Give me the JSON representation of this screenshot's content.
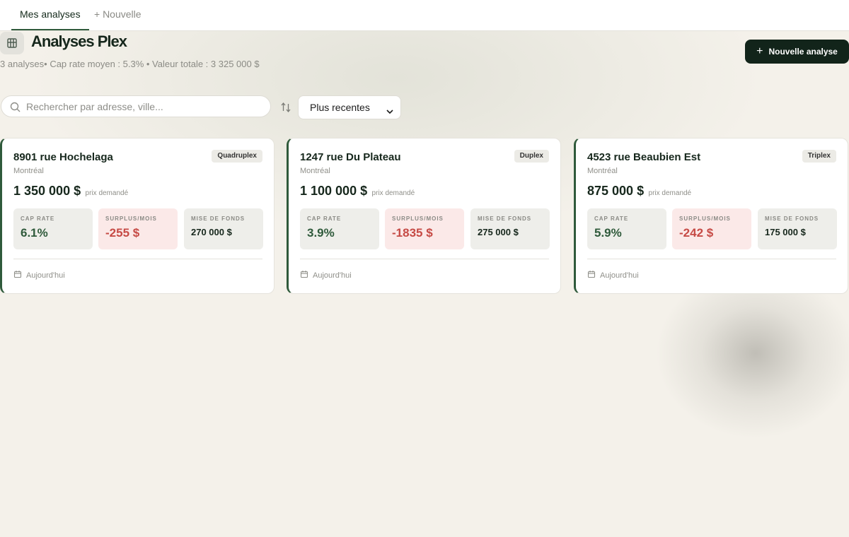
{
  "tabs": {
    "active": "Mes analyses",
    "new": "+ Nouvelle"
  },
  "header": {
    "title": "Analyses Plex",
    "subtitle": "3 analyses• Cap rate moyen : 5.3% • Valeur totale : 3 325 000 $",
    "new_button_label": "Nouvelle analyse",
    "logo_icon": "building-icon"
  },
  "search": {
    "placeholder": "Rechercher par adresse, ville...",
    "value": ""
  },
  "sort": {
    "selected": "Plus recentes",
    "icon": "sort-arrows-icon"
  },
  "colors": {
    "accent": "#2f5a3b",
    "dark": "#12241a",
    "negative": "#c64a45",
    "background": "#f4f1ea"
  },
  "metric_labels": {
    "cap_rate": "CAP RATE",
    "surplus": "SURPLUS/MOIS",
    "mise_de_fonds": "MISE DE FONDS"
  },
  "price_label": "prix demandé",
  "cards": [
    {
      "address": "8901 rue Hochelaga",
      "city": "Montréal",
      "type": "Quadruplex",
      "price": "1 350 000 $",
      "cap_rate": "6.1%",
      "surplus": "-255 $",
      "mise_de_fonds": "270 000 $",
      "date": "Aujourd'hui"
    },
    {
      "address": "1247 rue Du Plateau",
      "city": "Montréal",
      "type": "Duplex",
      "price": "1 100 000 $",
      "cap_rate": "3.9%",
      "surplus": "-1835 $",
      "mise_de_fonds": "275 000 $",
      "date": "Aujourd'hui"
    },
    {
      "address": "4523 rue Beaubien Est",
      "city": "Montréal",
      "type": "Triplex",
      "price": "875 000 $",
      "cap_rate": "5.9%",
      "surplus": "-242 $",
      "mise_de_fonds": "175 000 $",
      "date": "Aujourd'hui"
    }
  ]
}
